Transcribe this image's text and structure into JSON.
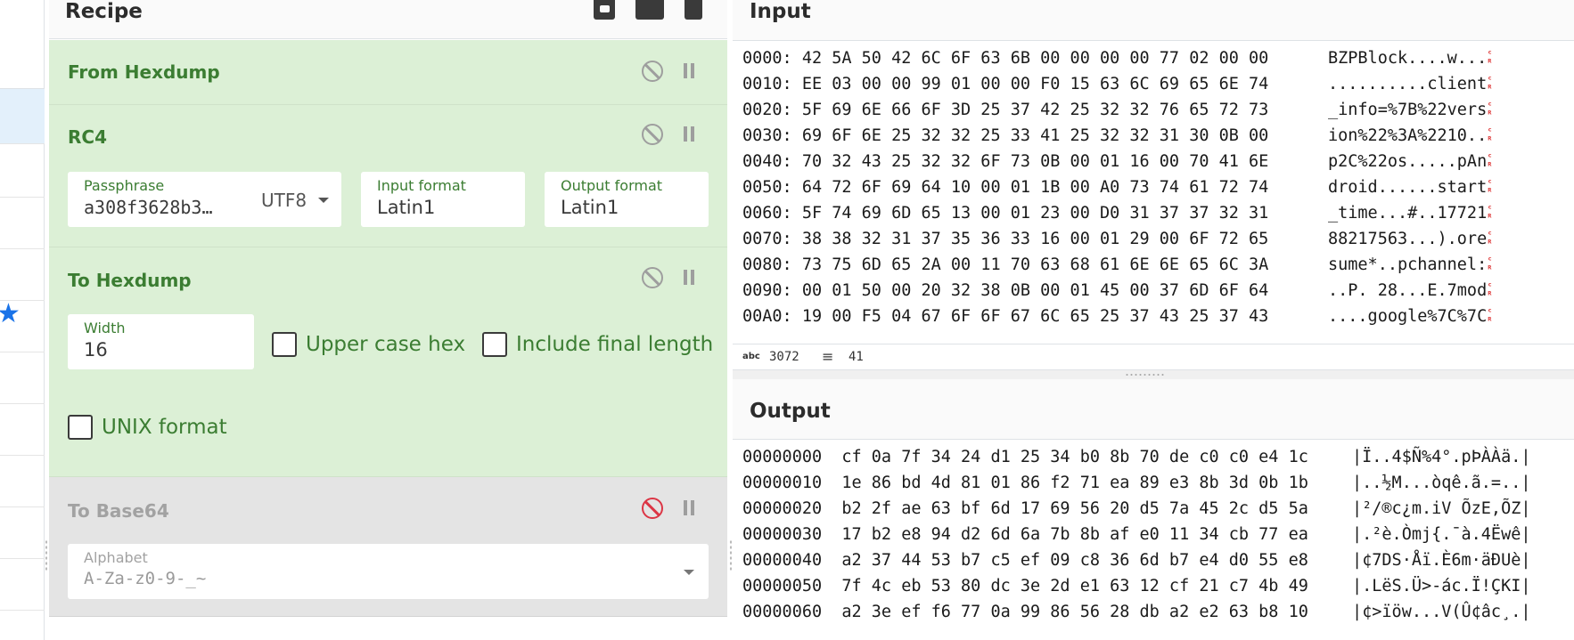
{
  "recipe": {
    "title": "Recipe",
    "operations": [
      {
        "name": "From Hexdump"
      },
      {
        "name": "RC4",
        "passphrase_label": "Passphrase",
        "passphrase_value": "a308f3628b3…",
        "passphrase_encoding": "UTF8",
        "input_format_label": "Input format",
        "input_format_value": "Latin1",
        "output_format_label": "Output format",
        "output_format_value": "Latin1"
      },
      {
        "name": "To Hexdump",
        "width_label": "Width",
        "width_value": "16",
        "upper_case_label": "Upper case hex",
        "include_final_length_label": "Include final length",
        "unix_format_label": "UNIX format"
      },
      {
        "name": "To Base64",
        "alphabet_label": "Alphabet",
        "alphabet_value": "A-Za-z0-9-_~"
      }
    ]
  },
  "input": {
    "title": "Input",
    "lines": [
      {
        "hex": "0000: 42 5A 50 42 6C 6F 63 6B 00 00 00 00 77 02 00 00",
        "ascii": "BZPBlock....w..."
      },
      {
        "hex": "0010: EE 03 00 00 99 01 00 00 F0 15 63 6C 69 65 6E 74",
        "ascii": "..........client"
      },
      {
        "hex": "0020: 5F 69 6E 66 6F 3D 25 37 42 25 32 32 76 65 72 73",
        "ascii": "_info=%7B%22vers"
      },
      {
        "hex": "0030: 69 6F 6E 25 32 32 25 33 41 25 32 32 31 30 0B 00",
        "ascii": "ion%22%3A%2210.."
      },
      {
        "hex": "0040: 70 32 43 25 32 32 6F 73 0B 00 01 16 00 70 41 6E",
        "ascii": "p2C%22os.....pAn"
      },
      {
        "hex": "0050: 64 72 6F 69 64 10 00 01 1B 00 A0 73 74 61 72 74",
        "ascii": "droid......start"
      },
      {
        "hex": "0060: 5F 74 69 6D 65 13 00 01 23 00 D0 31 37 37 32 31",
        "ascii": "_time...#..17721"
      },
      {
        "hex": "0070: 38 38 32 31 37 35 36 33 16 00 01 29 00 6F 72 65",
        "ascii": "88217563...).ore"
      },
      {
        "hex": "0080: 73 75 6D 65 2A 00 11 70 63 68 61 6E 6E 65 6C 3A",
        "ascii": "sume*..pchannel:"
      },
      {
        "hex": "0090: 00 01 50 00 20 32 38 0B 00 01 45 00 37 6D 6F 64",
        "ascii": "..P. 28...E.7mod"
      },
      {
        "hex": "00A0: 19 00 F5 04 67 6F 6F 67 6C 65 25 37 43 25 37 43",
        "ascii": "....google%7C%7C"
      }
    ],
    "stats": {
      "length_icon": "abc",
      "length": "3072",
      "lines_icon": "lines-icon",
      "lines": "41"
    }
  },
  "output": {
    "title": "Output",
    "lines": [
      {
        "hex": "00000000  cf 0a 7f 34 24 d1 25 34 b0 8b 70 de c0 c0 e4 1c",
        "ascii": "|Ï..4$Ñ%4°.pÞÀÀä.|"
      },
      {
        "hex": "00000010  1e 86 bd 4d 81 01 86 f2 71 ea 89 e3 8b 3d 0b 1b",
        "ascii": "|..½M...òqê.ã.=..|"
      },
      {
        "hex": "00000020  b2 2f ae 63 bf 6d 17 69 56 20 d5 7a 45 2c d5 5a",
        "ascii": "|²/®c¿m.iV ÕzE,ÕZ|"
      },
      {
        "hex": "00000030  17 b2 e8 94 d2 6d 6a 7b 8b af e0 11 34 cb 77 ea",
        "ascii": "|.²è.Òmj{.¯à.4Ëwê|"
      },
      {
        "hex": "00000040  a2 37 44 53 b7 c5 ef 09 c8 36 6d b7 e4 d0 55 e8",
        "ascii": "|¢7DS·Åï.È6m·äÐUè|"
      },
      {
        "hex": "00000050  7f 4c eb 53 80 dc 3e 2d e1 63 12 cf 21 c7 4b 49",
        "ascii": "|.LëS.Ü>-ác.Ï!ÇKI|"
      },
      {
        "hex": "00000060  a2 3e ef f6 77 0a 99 86 56 28 db a2 e2 63 b8 10",
        "ascii": "|¢>ïöw...V(Û¢âc¸.|"
      }
    ]
  },
  "colors": {
    "active_op_bg": "#dcf0d6",
    "disabled_op_bg": "#e4e4e4",
    "op_title_green": "#3b7d32",
    "disabled_icon_red": "#dc3545",
    "star_blue": "#1a73e8"
  }
}
